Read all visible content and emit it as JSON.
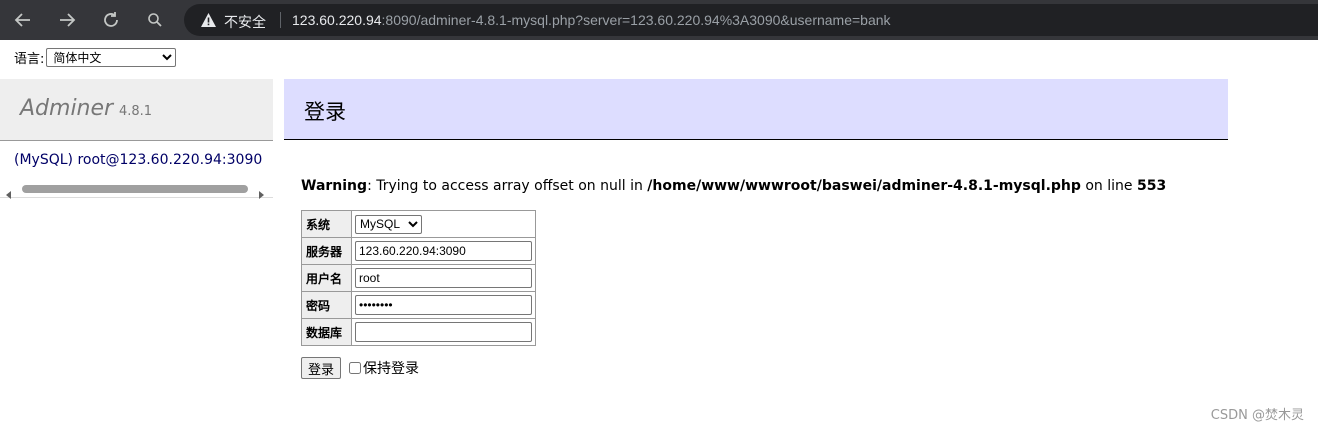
{
  "browser": {
    "security_label": "不安全",
    "url_host": "123.60.220.94",
    "url_rest": ":8090/adminer-4.8.1-mysql.php?server=123.60.220.94%3A3090&username=bank",
    "icons": [
      "back-icon",
      "forward-icon",
      "reload-icon",
      "search-icon",
      "warning-icon"
    ]
  },
  "language": {
    "label": "语言:",
    "selected": "简体中文"
  },
  "menu": {
    "brand": "Adminer",
    "version": "4.8.1",
    "connection": "(MySQL) root@123.60.220.94:3090"
  },
  "content": {
    "title": "登录",
    "warning_label": "Warning",
    "warning_text": ": Trying to access array offset on null in ",
    "warning_path": "/home/www/wwwroot/baswei/adminer-4.8.1-mysql.php",
    "warning_online": " on line ",
    "warning_line": "553"
  },
  "login_form": {
    "system_label": "系统",
    "system_value": "MySQL",
    "server_label": "服务器",
    "server_value": "123.60.220.94:3090",
    "username_label": "用户名",
    "username_value": "root",
    "password_label": "密码",
    "password_value": "••••••••",
    "database_label": "数据库",
    "database_value": "",
    "submit_label": "登录",
    "remember_label": "保持登录"
  },
  "watermark": "CSDN @焚木灵",
  "colors": {
    "chrome_bg": "#35363a",
    "omnibox_bg": "#202124",
    "menu_head_bg": "#eeeeee",
    "content_head_bg": "#ddddff",
    "link_color": "#000066"
  }
}
